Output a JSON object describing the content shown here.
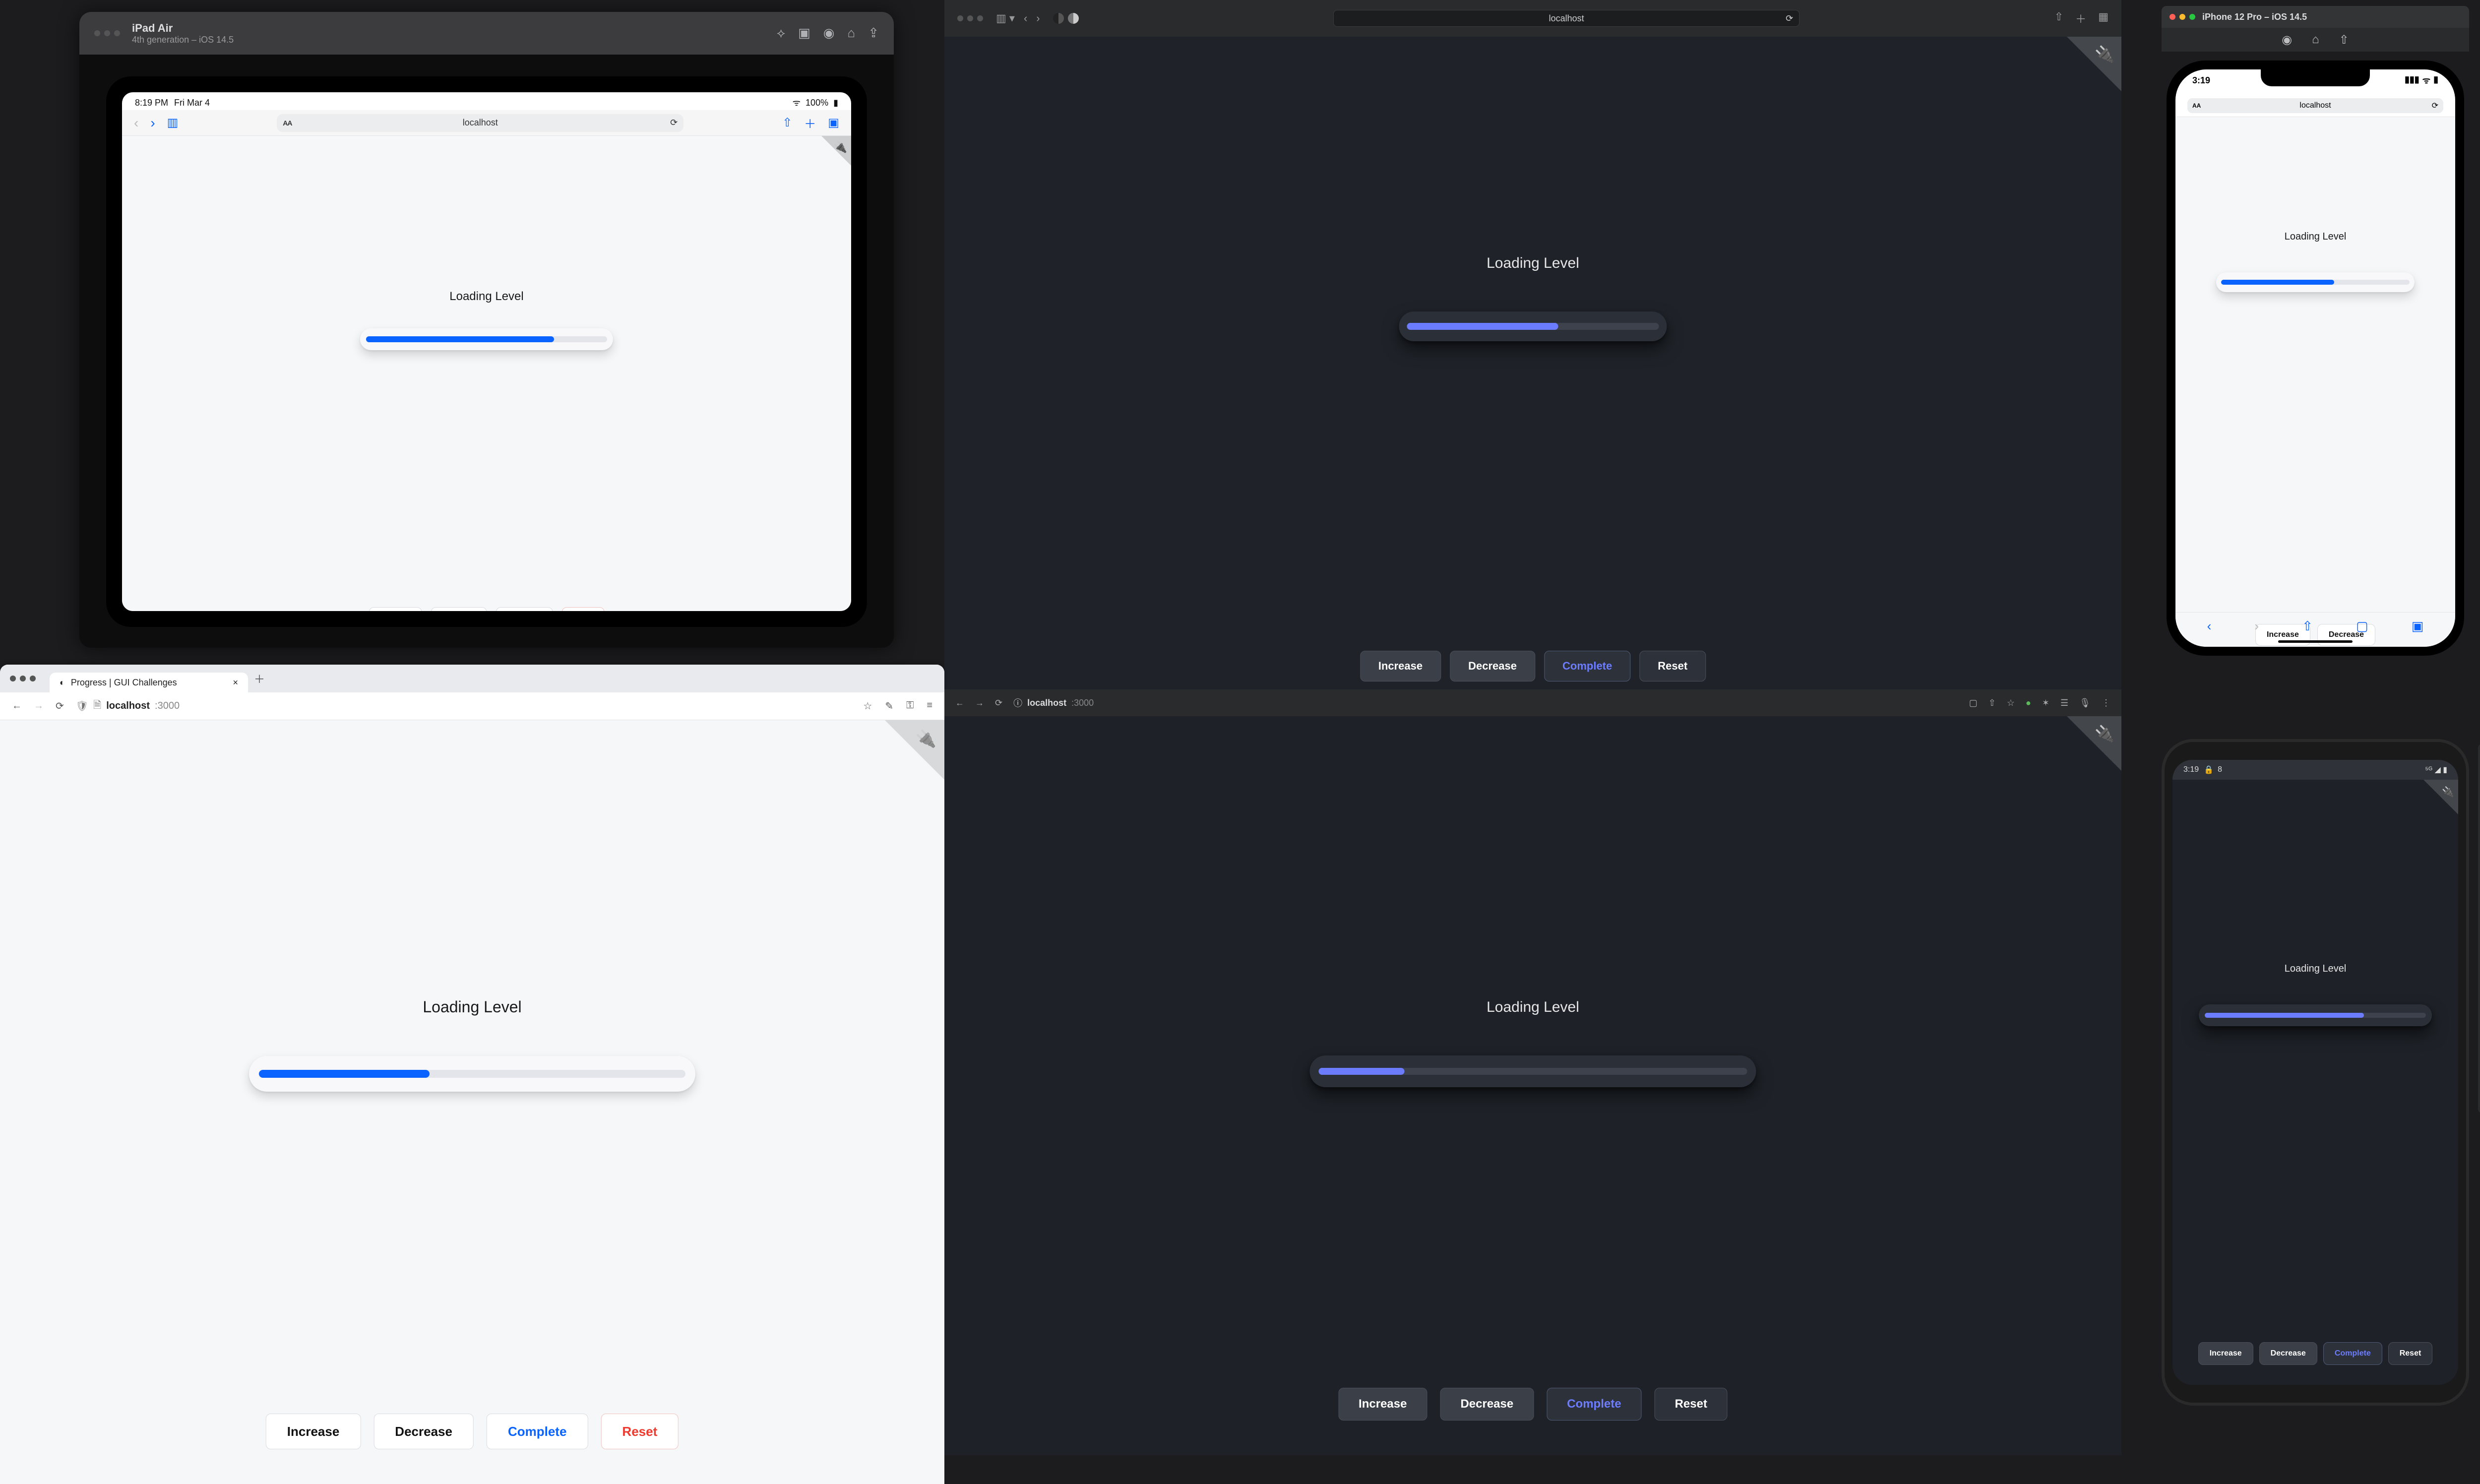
{
  "demo": {
    "loading_label": "Loading Level",
    "buttons": {
      "increase": "Increase",
      "decrease": "Decrease",
      "complete": "Complete",
      "reset": "Reset"
    }
  },
  "ipad": {
    "title": "iPad Air",
    "subtitle": "4th generation – iOS 14.5",
    "status_time": "8:19 PM",
    "status_date": "Fri Mar 4",
    "status_wifi": "100%",
    "url": "localhost",
    "progress_pct": 78
  },
  "iphone": {
    "title": "iPhone 12 Pro – iOS 14.5",
    "status_time": "3:19",
    "url": "localhost",
    "progress_pct": 60
  },
  "safari": {
    "url": "localhost",
    "progress_pct": 60
  },
  "chrome_light": {
    "tab_title": "Progress | GUI Challenges",
    "host": "localhost",
    "port": ":3000",
    "progress_pct": 40
  },
  "chrome_dark": {
    "host": "localhost",
    "port": ":3000",
    "progress_pct": 20
  },
  "android": {
    "status_time": "3:19",
    "status_extra": "8",
    "progress_pct": 72
  }
}
